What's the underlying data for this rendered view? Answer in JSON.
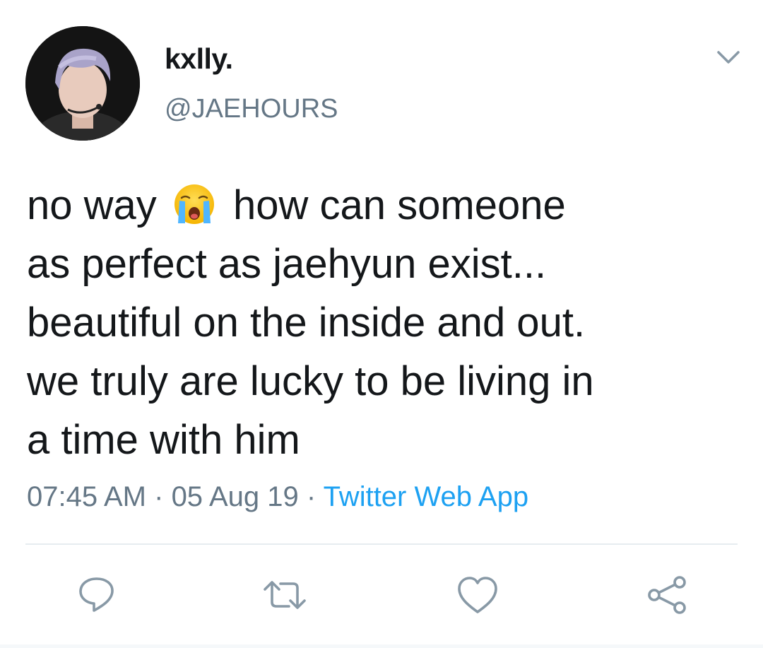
{
  "user": {
    "display_name": "kxlly.",
    "handle": "@JAEHOURS",
    "avatar_icon": "profile-photo-avatar"
  },
  "tweet": {
    "text_part1": "no way ",
    "emoji_icon": "loudly-crying-face-emoji",
    "text_part2": " how can someone\nas perfect as jaehyun exist...\nbeautiful on the inside and out.\nwe truly are lucky to be living in\na time with him"
  },
  "meta": {
    "time": "07:45 AM",
    "separator": " · ",
    "date": "05 Aug 19",
    "source": "Twitter Web App"
  },
  "actions": {
    "reply_icon": "reply-icon",
    "retweet_icon": "retweet-icon",
    "like_icon": "heart-icon",
    "share_icon": "share-icon"
  },
  "colors": {
    "text_primary": "#14171a",
    "text_secondary": "#657786",
    "accent": "#1da1f2",
    "divider": "#e6ecf0"
  }
}
